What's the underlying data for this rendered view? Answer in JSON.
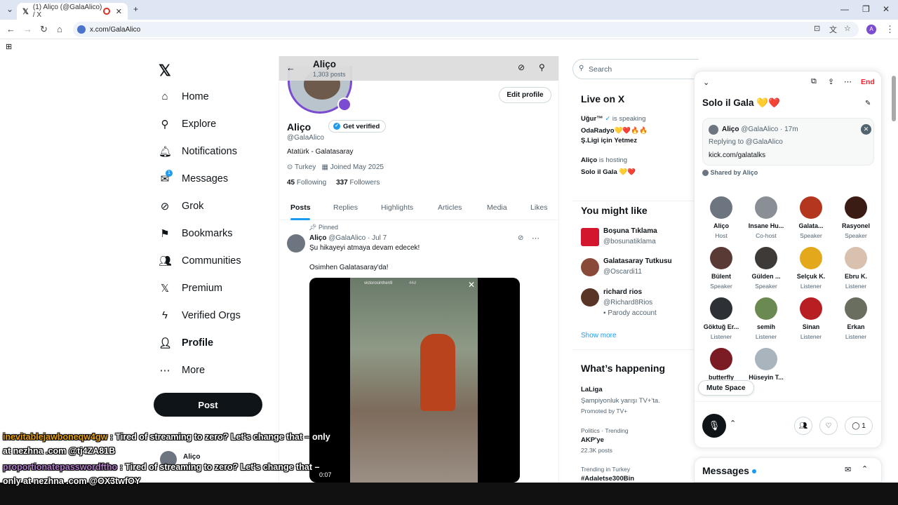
{
  "browser": {
    "tab_title": "(1) Aliço (@GalaAlico) / X",
    "url": "x.com/GalaAlico",
    "profile_initial": "A"
  },
  "nav": {
    "items": [
      {
        "label": "Home",
        "icon": "home-icon"
      },
      {
        "label": "Explore",
        "icon": "search-icon"
      },
      {
        "label": "Notifications",
        "icon": "bell-icon"
      },
      {
        "label": "Messages",
        "icon": "mail-icon",
        "badge": "1"
      },
      {
        "label": "Grok",
        "icon": "grok-icon"
      },
      {
        "label": "Bookmarks",
        "icon": "bookmark-icon"
      },
      {
        "label": "Communities",
        "icon": "communities-icon"
      },
      {
        "label": "Premium",
        "icon": "x-icon"
      },
      {
        "label": "Verified Orgs",
        "icon": "lightning-icon"
      },
      {
        "label": "Profile",
        "icon": "person-icon"
      },
      {
        "label": "More",
        "icon": "more-icon"
      }
    ],
    "post_label": "Post",
    "mini_user": "Aliço"
  },
  "profile": {
    "header_name": "Aliço",
    "post_count": "1,303 posts",
    "edit_label": "Edit profile",
    "name": "Aliço",
    "get_verified": "Get verified",
    "handle": "@GalaAlico",
    "bio": "Atatürk - Galatasaray",
    "location": "Turkey",
    "joined": "Joined May 2025",
    "following_count": "45",
    "following_label": "Following",
    "followers_count": "337",
    "followers_label": "Followers",
    "tabs": [
      "Posts",
      "Replies",
      "Highlights",
      "Articles",
      "Media",
      "Likes"
    ]
  },
  "tweet": {
    "pinned": "Pinned",
    "name": "Aliço",
    "meta": "@GalaAlico · Jul 7",
    "line1": "Şu hikayeyi atmaya devam edecek!",
    "line2": "Osimhen Galatasaray'da!",
    "video_time": "0:07",
    "video_user": "victorosimhen9",
    "video_age": "44d"
  },
  "right": {
    "search_placeholder": "Search",
    "live_title": "Live on X",
    "live": [
      {
        "user": "Uğur™",
        "status": "is speaking",
        "title1": "OdaRadyo💛❤️🔥🔥",
        "title2": "Ş.Ligi için Yetmez"
      },
      {
        "user": "Aliço",
        "status": "is hosting",
        "title1": "Solo il Gala 💛❤️",
        "title2": ""
      }
    ],
    "might_like_title": "You might like",
    "might_like": [
      {
        "name": "Boşuna Tıklama",
        "handle": "@bosunatiklama",
        "extra": ""
      },
      {
        "name": "Galatasaray Tutkusu",
        "handle": "@Oscardi11",
        "extra": ""
      },
      {
        "name": "richard rios",
        "handle": "@Richard8Rios",
        "extra": "Parody account"
      }
    ],
    "show_more": "Show more",
    "happening_title": "What’s happening",
    "happening": [
      {
        "context": "LaLiga",
        "title": "Şampiyonluk yarışı TV+'ta.",
        "sub": "Promoted by TV+"
      },
      {
        "context": "Politics · Trending",
        "title": "AKP'ye",
        "sub": "22.3K posts"
      },
      {
        "context": "Trending in Turkey",
        "title": "#Adaletse300Bin",
        "sub": ""
      }
    ]
  },
  "space": {
    "end_label": "End",
    "title": "Solo il Gala 💛❤️",
    "card_name": "Aliço",
    "card_meta": "@GalaAlico · 17m",
    "card_reply": "Replying to @GalaAlico",
    "card_link": "kick.com/galatalks",
    "shared_by": "Shared by Aliço",
    "participants": [
      {
        "name": "Aliço",
        "role": "Host",
        "color": "#6d7580"
      },
      {
        "name": "Insane Hu...",
        "role": "Co-host",
        "color": "#8a8f96"
      },
      {
        "name": "Galata...",
        "role": "Speaker",
        "color": "#b5361f"
      },
      {
        "name": "Rasyonel",
        "role": "Speaker",
        "color": "#3a1c14"
      },
      {
        "name": "Bülent",
        "role": "Speaker",
        "color": "#5a3a34"
      },
      {
        "name": "Gülden ...",
        "role": "Speaker",
        "color": "#3d3a38"
      },
      {
        "name": "Selçuk K.",
        "role": "Listener",
        "color": "#e3a81c"
      },
      {
        "name": "Ebru K.",
        "role": "Listener",
        "color": "#d9c1b0"
      },
      {
        "name": "Göktuğ Er...",
        "role": "Listener",
        "color": "#2d3136"
      },
      {
        "name": "semih",
        "role": "Listener",
        "color": "#6b8a52"
      },
      {
        "name": "Sinan",
        "role": "Listener",
        "color": "#b71f23"
      },
      {
        "name": "Erkan",
        "role": "Listener",
        "color": "#6a6e5e"
      },
      {
        "name": "butterfly",
        "role": "",
        "color": "#7b1c24"
      },
      {
        "name": "Hüseyin T...",
        "role": "",
        "color": "#aab4bd"
      }
    ],
    "mute_label": "Mute Space",
    "reply_count": "1"
  },
  "messages_title": "Messages",
  "chat": [
    {
      "user": "inevitablejawboneqw4gw",
      "text": ": Tired of streaming to zero? Let's change that – only at nezhna .com @tj4ZA81B"
    },
    {
      "user": "proportionatepasswordftho",
      "text": ": Tired of streaming to zero? Let's change that – only at nezhna .com @OX3twfOY"
    }
  ]
}
